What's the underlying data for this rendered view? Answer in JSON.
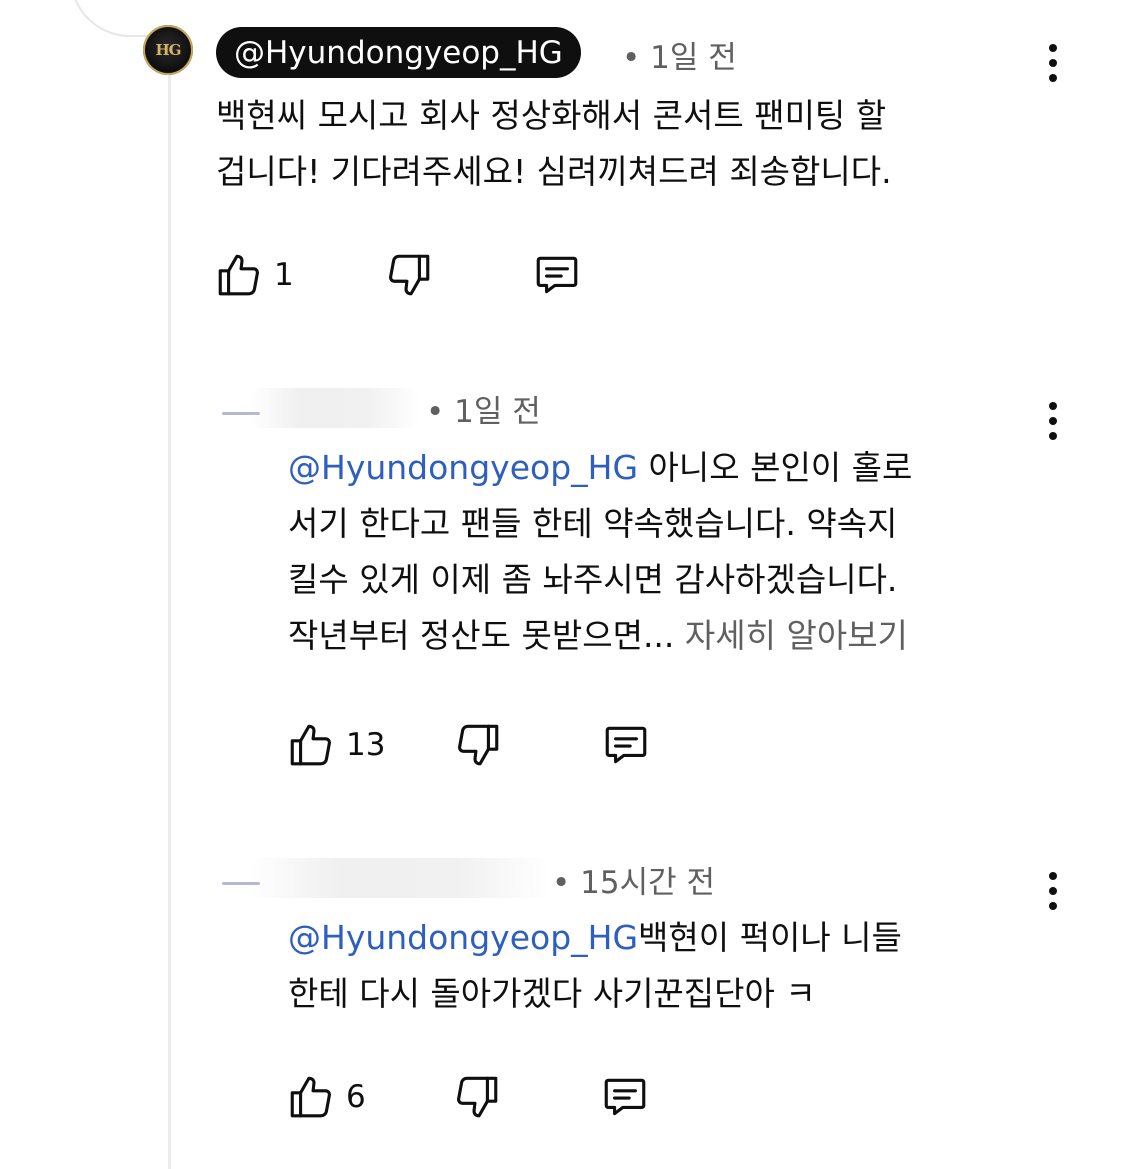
{
  "comments": [
    {
      "author": "@Hyundongyeop_HG",
      "avatar_text": "HG",
      "time": "• 1일 전",
      "text_line1": "백현씨 모시고 회사 정상화해서 콘서트 팬미팅 할",
      "text_line2": "겁니다! 기다려주세요! 심려끼쳐드려 죄송합니다.",
      "likes": "1"
    },
    {
      "author_partial": "",
      "time": "• 1일 전",
      "mention": "@Hyundongyeop_HG",
      "text_line1_rest": " 아니오 본인이 홀로",
      "text_line2": "서기 한다고 팬들 한테 약속했습니다. 약속지",
      "text_line3": "킬수 있게 이제 좀 놔주시면 감사하겠습니다.",
      "text_line4": "작년부터 정산도 못받으면...",
      "read_more": " 자세히 알아보기",
      "likes": "13"
    },
    {
      "author_partial": "",
      "time": "• 15시간 전",
      "mention": "@Hyundongyeop_HG",
      "text_line1_rest": "백현이 퍽이나 니들",
      "text_line2": "한테 다시 돌아가겠다 사기꾼집단아 ㅋ",
      "likes": "6"
    }
  ],
  "icons": {
    "like": "thumbs-up-icon",
    "dislike": "thumbs-down-icon",
    "reply": "reply-comment-icon",
    "menu": "more-vertical-icon"
  }
}
